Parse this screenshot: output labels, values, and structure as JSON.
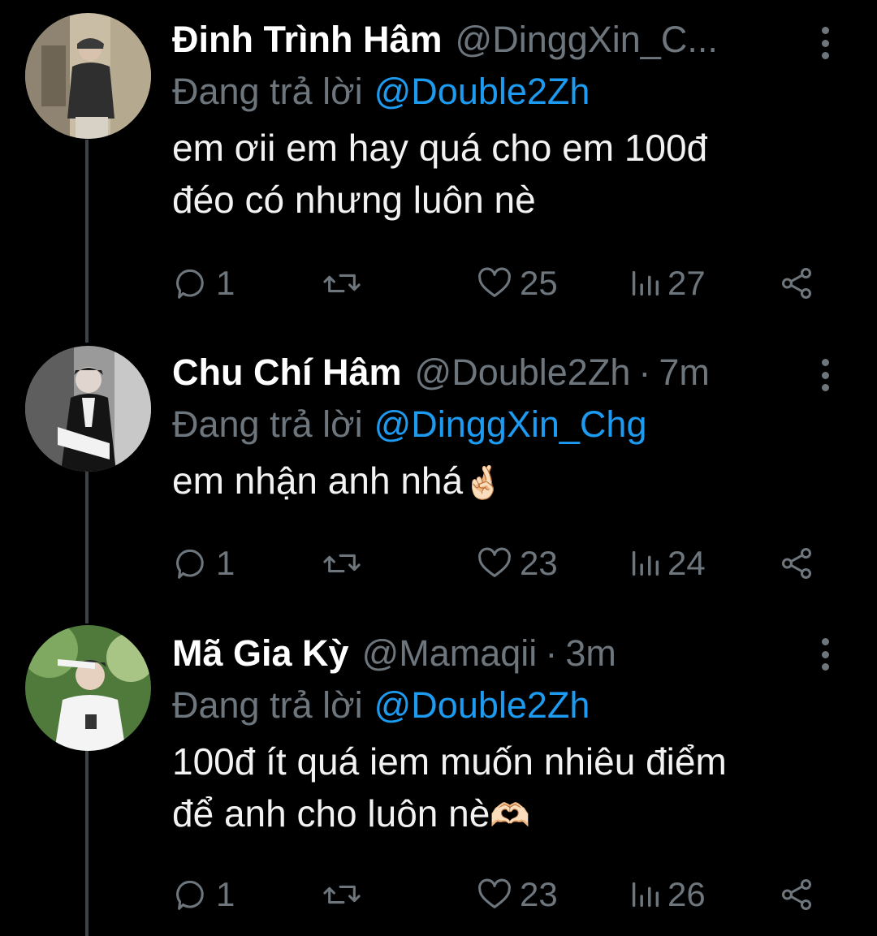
{
  "colors": {
    "background": "#000000",
    "name": "#ffffff",
    "secondary": "#6e767d",
    "link": "#1d9bf0",
    "thread_line": "#3d4247"
  },
  "tweets": [
    {
      "name": "Đinh Trình Hâm",
      "handle": "@DinggXin_C...",
      "separator": "",
      "time": "",
      "reply_label": "Đang trả lời",
      "reply_to": "@Double2Zh",
      "text_line1": "em ơii em hay quá cho em 100đ",
      "text_line2": "đéo có nhưng luôn nè",
      "emoji": "",
      "replies": "1",
      "likes": "25",
      "views": "27",
      "icons": [
        "more-icon",
        "reply-icon",
        "retweet-icon",
        "like-icon",
        "views-icon",
        "share-icon"
      ]
    },
    {
      "name": "Chu Chí Hâm",
      "handle": "@Double2Zh",
      "separator": "·",
      "time": "7m",
      "reply_label": "Đang trả lời",
      "reply_to": "@DinggXin_Chg",
      "text_line1": "em nhận anh nhá",
      "text_line2": "",
      "emoji": "🤞🏻",
      "replies": "1",
      "likes": "23",
      "views": "24",
      "icons": [
        "more-icon",
        "reply-icon",
        "retweet-icon",
        "like-icon",
        "views-icon",
        "share-icon"
      ]
    },
    {
      "name": "Mã Gia Kỳ",
      "handle": "@Mamaqii",
      "separator": "·",
      "time": "3m",
      "reply_label": "Đang trả lời",
      "reply_to": "@Double2Zh",
      "text_line1": "100đ ít quá iem muốn nhiêu điểm",
      "text_line2": "để anh cho luôn nè",
      "emoji": "🫶🏻",
      "replies": "1",
      "likes": "23",
      "views": "26",
      "icons": [
        "more-icon",
        "reply-icon",
        "retweet-icon",
        "like-icon",
        "views-icon",
        "share-icon"
      ]
    }
  ]
}
